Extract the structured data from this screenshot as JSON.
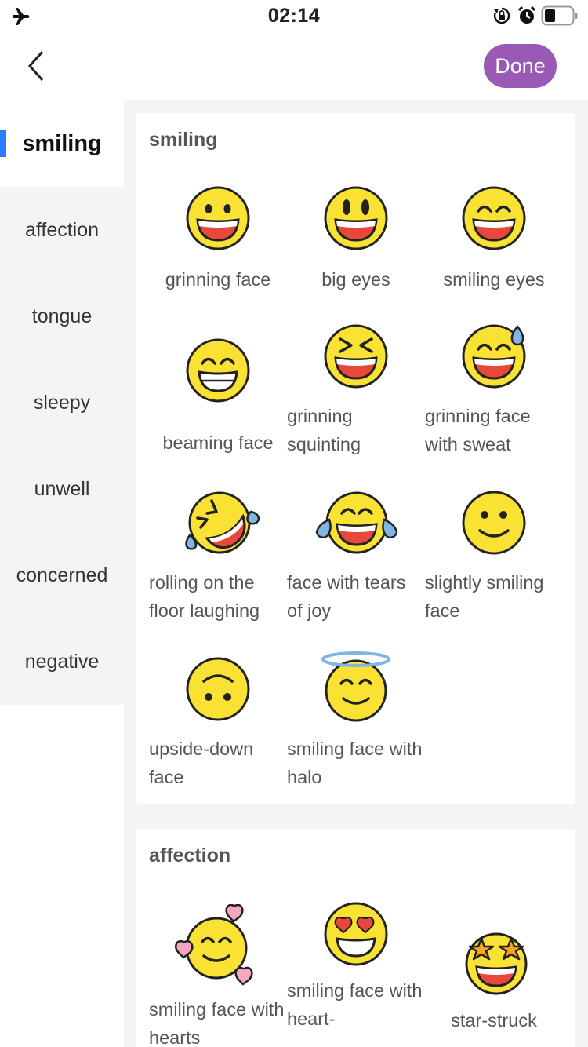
{
  "status_bar": {
    "time": "02:14",
    "icons": [
      "airplane-icon",
      "orientation-lock-icon",
      "alarm-icon",
      "battery-icon"
    ]
  },
  "nav": {
    "done_label": "Done",
    "back_icon": "chevron-left-icon",
    "accent_color": "#9b59b6"
  },
  "sidebar": {
    "active_index": 0,
    "items": [
      {
        "label": "smiling"
      },
      {
        "label": "affection"
      },
      {
        "label": "tongue"
      },
      {
        "label": "sleepy"
      },
      {
        "label": "unwell"
      },
      {
        "label": "concerned"
      },
      {
        "label": "negative"
      }
    ]
  },
  "sections": [
    {
      "title": "smiling",
      "emojis": [
        {
          "name": "grinning face"
        },
        {
          "name": "big eyes"
        },
        {
          "name": "smiling eyes"
        },
        {
          "name": "beaming face"
        },
        {
          "name": "grinning squinting"
        },
        {
          "name": "grinning face with sweat"
        },
        {
          "name": "rolling on the floor laughing"
        },
        {
          "name": "face with tears of joy"
        },
        {
          "name": "slightly smiling face"
        },
        {
          "name": "upside-down face"
        },
        {
          "name": "smiling face with halo"
        }
      ]
    },
    {
      "title": "affection",
      "emojis": [
        {
          "name": "smiling face with hearts"
        },
        {
          "name": "smiling face with heart-"
        },
        {
          "name": "star-struck"
        }
      ]
    }
  ]
}
